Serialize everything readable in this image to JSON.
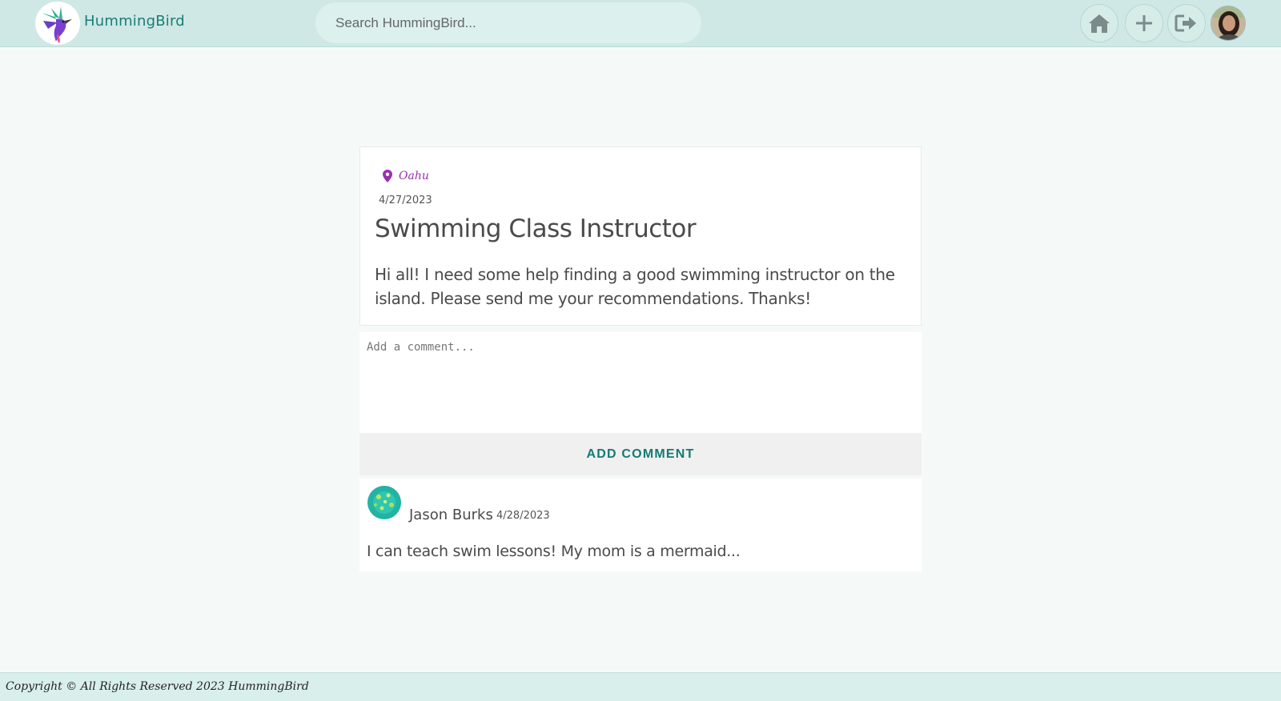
{
  "header": {
    "brand": "HummingBird",
    "search_placeholder": "Search HummingBird..."
  },
  "post": {
    "location": "Oahu",
    "date": "4/27/2023",
    "title": "Swimming Class Instructor",
    "body": "Hi all! I need some help finding a good swimming instructor on the island. Please send me your recommendations. Thanks!"
  },
  "comment_form": {
    "placeholder": "Add a comment...",
    "button_label": "ADD COMMENT"
  },
  "comments": [
    {
      "author": "Jason Burks",
      "date": "4/28/2023",
      "text": "I can teach swim lessons! My mom is a mermaid..."
    }
  ],
  "footer": {
    "text": "Copyright © All Rights Reserved 2023 HummingBird"
  },
  "colors": {
    "header_bg": "#cfe8e5",
    "accent": "#1a7d77",
    "location": "#9a2fb0"
  },
  "icons": [
    "hummingbird-logo",
    "home-icon",
    "plus-icon",
    "logout-icon",
    "map-pin-icon"
  ]
}
